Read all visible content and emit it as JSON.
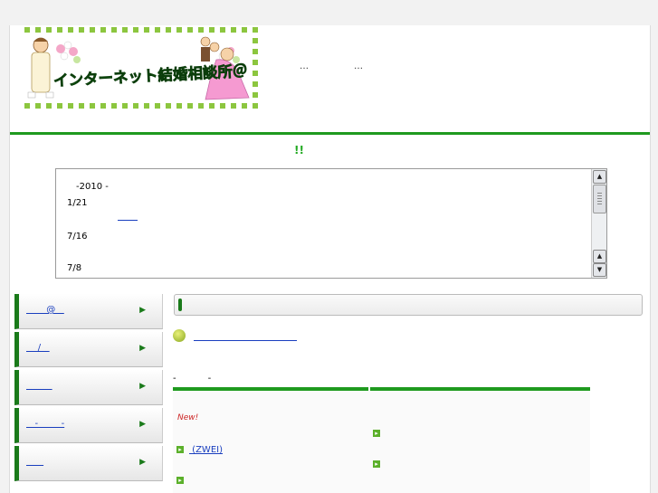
{
  "header": {
    "logo_text": "インターネット結婚相談所＠",
    "dots": [
      "…",
      "…"
    ]
  },
  "alert": "!!",
  "news": {
    "year_label": "-2010 -",
    "entries": [
      {
        "date": "1/21"
      },
      {
        "date": "7/16"
      },
      {
        "date": "7/8"
      }
    ]
  },
  "sidebar": {
    "items": [
      {
        "label": "       @   "
      },
      {
        "label": "    /   "
      },
      {
        "label": "         "
      },
      {
        "label": "   -        -"
      },
      {
        "label": "      "
      }
    ]
  },
  "progress": {
    "fraction": 0.01
  },
  "section_title": "-           -",
  "table": {
    "left": [
      {
        "new": "New!",
        "label": "    "
      },
      {
        "label": "  (ZWEI)"
      },
      {
        "label": "         "
      }
    ],
    "right": [
      {
        "label": "    "
      },
      {
        "label": "  "
      }
    ]
  },
  "colors": {
    "accent": "#1f9a1f",
    "link": "#1a3fbf",
    "new": "#cc2222"
  }
}
